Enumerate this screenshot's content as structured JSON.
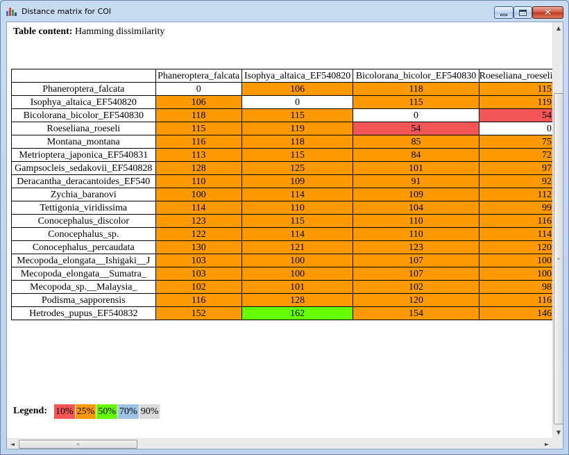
{
  "window": {
    "title": "Distance matrix for COI"
  },
  "content_title": {
    "label": "Table content:",
    "value": "Hamming dissimilarity"
  },
  "colors": {
    "white": "#ffffff",
    "red": "#f45557",
    "orange": "#ff9900",
    "green": "#66ff00",
    "blue": "#9cc3e5",
    "gray": "#d9d9d9"
  },
  "table": {
    "columns": [
      "Phaneroptera_falcata",
      "Isophya_altaica_EF540820",
      "Bicolorana_bicolor_EF540830",
      "Roeseliana_roeseli"
    ],
    "rows": [
      {
        "name": "Phaneroptera_falcata",
        "values": [
          "0",
          "106",
          "118",
          "115"
        ],
        "colors": [
          "white",
          "orange",
          "orange",
          "orange"
        ]
      },
      {
        "name": "Isophya_altaica_EF540820",
        "values": [
          "106",
          "0",
          "115",
          "119"
        ],
        "colors": [
          "orange",
          "white",
          "orange",
          "orange"
        ]
      },
      {
        "name": "Bicolorana_bicolor_EF540830",
        "values": [
          "118",
          "115",
          "0",
          "54"
        ],
        "colors": [
          "orange",
          "orange",
          "white",
          "red"
        ]
      },
      {
        "name": "Roeseliana_roeseli",
        "values": [
          "115",
          "119",
          "54",
          "0"
        ],
        "colors": [
          "orange",
          "orange",
          "red",
          "white"
        ]
      },
      {
        "name": "Montana_montana",
        "values": [
          "116",
          "118",
          "85",
          "75"
        ],
        "colors": [
          "orange",
          "orange",
          "orange",
          "orange"
        ]
      },
      {
        "name": "Metrioptera_japonica_EF540831",
        "values": [
          "113",
          "115",
          "84",
          "72"
        ],
        "colors": [
          "orange",
          "orange",
          "orange",
          "orange"
        ]
      },
      {
        "name": "Gampsocleis_sedakovii_EF540828",
        "values": [
          "128",
          "125",
          "101",
          "97"
        ],
        "colors": [
          "orange",
          "orange",
          "orange",
          "orange"
        ]
      },
      {
        "name": "Deracantha_deracantoides_EF540",
        "values": [
          "110",
          "109",
          "91",
          "92"
        ],
        "colors": [
          "orange",
          "orange",
          "orange",
          "orange"
        ]
      },
      {
        "name": "Zychia_baranovi",
        "values": [
          "100",
          "114",
          "109",
          "112"
        ],
        "colors": [
          "orange",
          "orange",
          "orange",
          "orange"
        ]
      },
      {
        "name": "Tettigonia_viridissima",
        "values": [
          "114",
          "110",
          "104",
          "99"
        ],
        "colors": [
          "orange",
          "orange",
          "orange",
          "orange"
        ]
      },
      {
        "name": "Conocephalus_discolor",
        "values": [
          "123",
          "115",
          "110",
          "116"
        ],
        "colors": [
          "orange",
          "orange",
          "orange",
          "orange"
        ]
      },
      {
        "name": "Conocephalus_sp.",
        "values": [
          "122",
          "114",
          "110",
          "114"
        ],
        "colors": [
          "orange",
          "orange",
          "orange",
          "orange"
        ]
      },
      {
        "name": "Conocephalus_percaudata",
        "values": [
          "130",
          "121",
          "123",
          "120"
        ],
        "colors": [
          "orange",
          "orange",
          "orange",
          "orange"
        ]
      },
      {
        "name": "Mecopoda_elongata__Ishigaki__J",
        "values": [
          "103",
          "100",
          "107",
          "100"
        ],
        "colors": [
          "orange",
          "orange",
          "orange",
          "orange"
        ]
      },
      {
        "name": "Mecopoda_elongata__Sumatra_",
        "values": [
          "103",
          "100",
          "107",
          "100"
        ],
        "colors": [
          "orange",
          "orange",
          "orange",
          "orange"
        ]
      },
      {
        "name": "Mecopoda_sp.__Malaysia_",
        "values": [
          "102",
          "101",
          "102",
          "98"
        ],
        "colors": [
          "orange",
          "orange",
          "orange",
          "orange"
        ]
      },
      {
        "name": "Podisma_sapporensis",
        "values": [
          "116",
          "128",
          "120",
          "116"
        ],
        "colors": [
          "orange",
          "orange",
          "orange",
          "orange"
        ]
      },
      {
        "name": "Hetrodes_pupus_EF540832",
        "values": [
          "152",
          "162",
          "154",
          "146"
        ],
        "colors": [
          "orange",
          "green",
          "orange",
          "orange"
        ]
      }
    ]
  },
  "legend": {
    "label": "Legend:",
    "items": [
      {
        "text": "10%",
        "color": "red"
      },
      {
        "text": "25%",
        "color": "orange"
      },
      {
        "text": "50%",
        "color": "green"
      },
      {
        "text": "70%",
        "color": "blue"
      },
      {
        "text": "90%",
        "color": "gray"
      }
    ]
  },
  "scrollbar": {
    "up_arrow": "▲",
    "down_arrow": "▼",
    "left_arrow": "◄",
    "right_arrow": "►",
    "grip": "≡"
  }
}
